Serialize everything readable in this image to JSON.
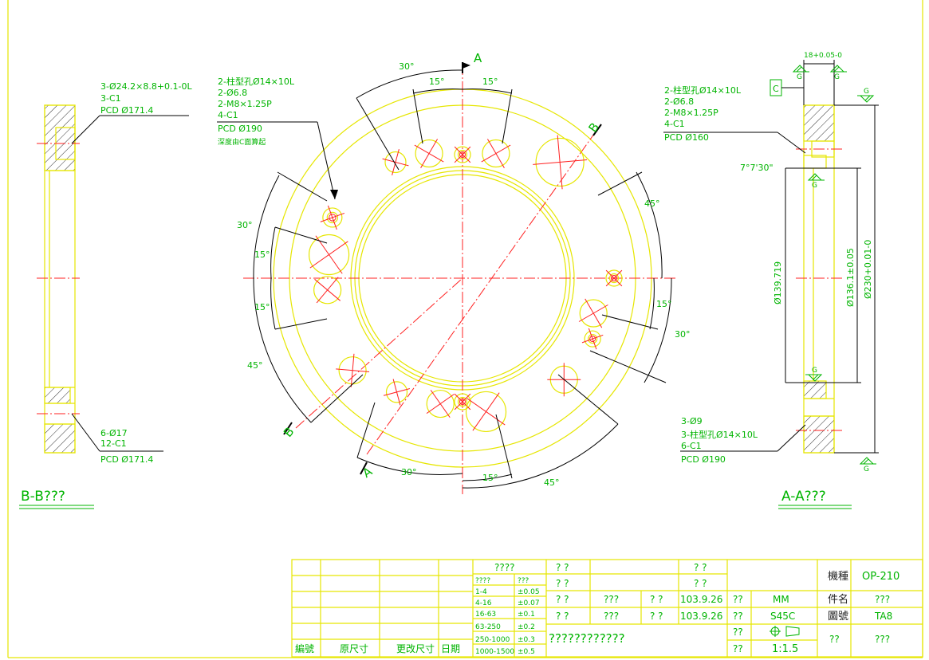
{
  "views": {
    "section_bb_title": "B-B???",
    "section_aa_title": "A-A???",
    "cut_labels": {
      "a": "A",
      "b": "B"
    }
  },
  "notes": {
    "left_top": [
      "3-Ø24.2×8.8+0.1-0L",
      "3-C1",
      "PCD Ø171.4"
    ],
    "left_bottom": [
      "6-Ø17",
      "12-C1",
      "PCD Ø171.4"
    ],
    "center_top": [
      "2-柱型孔Ø14×10L",
      "2-Ø6.8",
      "2-M8×1.25P",
      "4-C1",
      "PCD Ø190",
      "深度由C面算起"
    ],
    "right_top": [
      "2-柱型孔Ø14×10L",
      "2-Ø6.8",
      "2-M8×1.25P",
      "4-C1",
      "PCD Ø160"
    ],
    "right_bottom": [
      "3-Ø9",
      "3-柱型孔Ø14×10L",
      "6-C1",
      "PCD Ø190"
    ]
  },
  "dimensions": {
    "angles": [
      "30°",
      "15°",
      "15°",
      "45°",
      "30°",
      "15°",
      "15°",
      "45°",
      "15°",
      "30°",
      "30°",
      "15°",
      "45°"
    ],
    "thickness": "18+0.05-0",
    "chamfer_angle": "7°7'30\"",
    "diameters": [
      "Ø139.719",
      "Ø136.1±0.05",
      "Ø230+0.01-0"
    ],
    "datum": "C",
    "surface_mark": "G"
  },
  "tolerance_table": {
    "header": "????",
    "col_headers": [
      "????",
      "???"
    ],
    "rows": [
      [
        "1-4",
        "±0.05"
      ],
      [
        "4-16",
        "±0.07"
      ],
      [
        "16-63",
        "±0.1"
      ],
      [
        "63-250",
        "±0.2"
      ],
      [
        "250-1000",
        "±0.3"
      ],
      [
        "1000-1500",
        "±0.5"
      ]
    ]
  },
  "revision": {
    "labels": [
      "編號",
      "原尺寸",
      "更改尺寸",
      "日期"
    ]
  },
  "title_block": {
    "q1": "? ?",
    "q2": "? ?",
    "q3": "? ?",
    "q4": "? ?",
    "q5": "? ?",
    "q6": "? ?",
    "r3a": "???",
    "r3b": "? ?",
    "r3c": "103.9.26",
    "r3d": "??",
    "r3e": "MM",
    "r4a": "???",
    "r4b": "? ?",
    "r4c": "103.9.26",
    "r4d": "??",
    "r4e": "S45C",
    "company": "????????????",
    "r5d": "??",
    "r6d": "??",
    "scale": "1:1.5",
    "machine_label": "機種",
    "machine_value": "OP-210",
    "part_label": "件名",
    "part_value": "???",
    "drawing_label": "圖號",
    "drawing_value": "TA8",
    "bottom_label": "??",
    "bottom_value": "???"
  }
}
